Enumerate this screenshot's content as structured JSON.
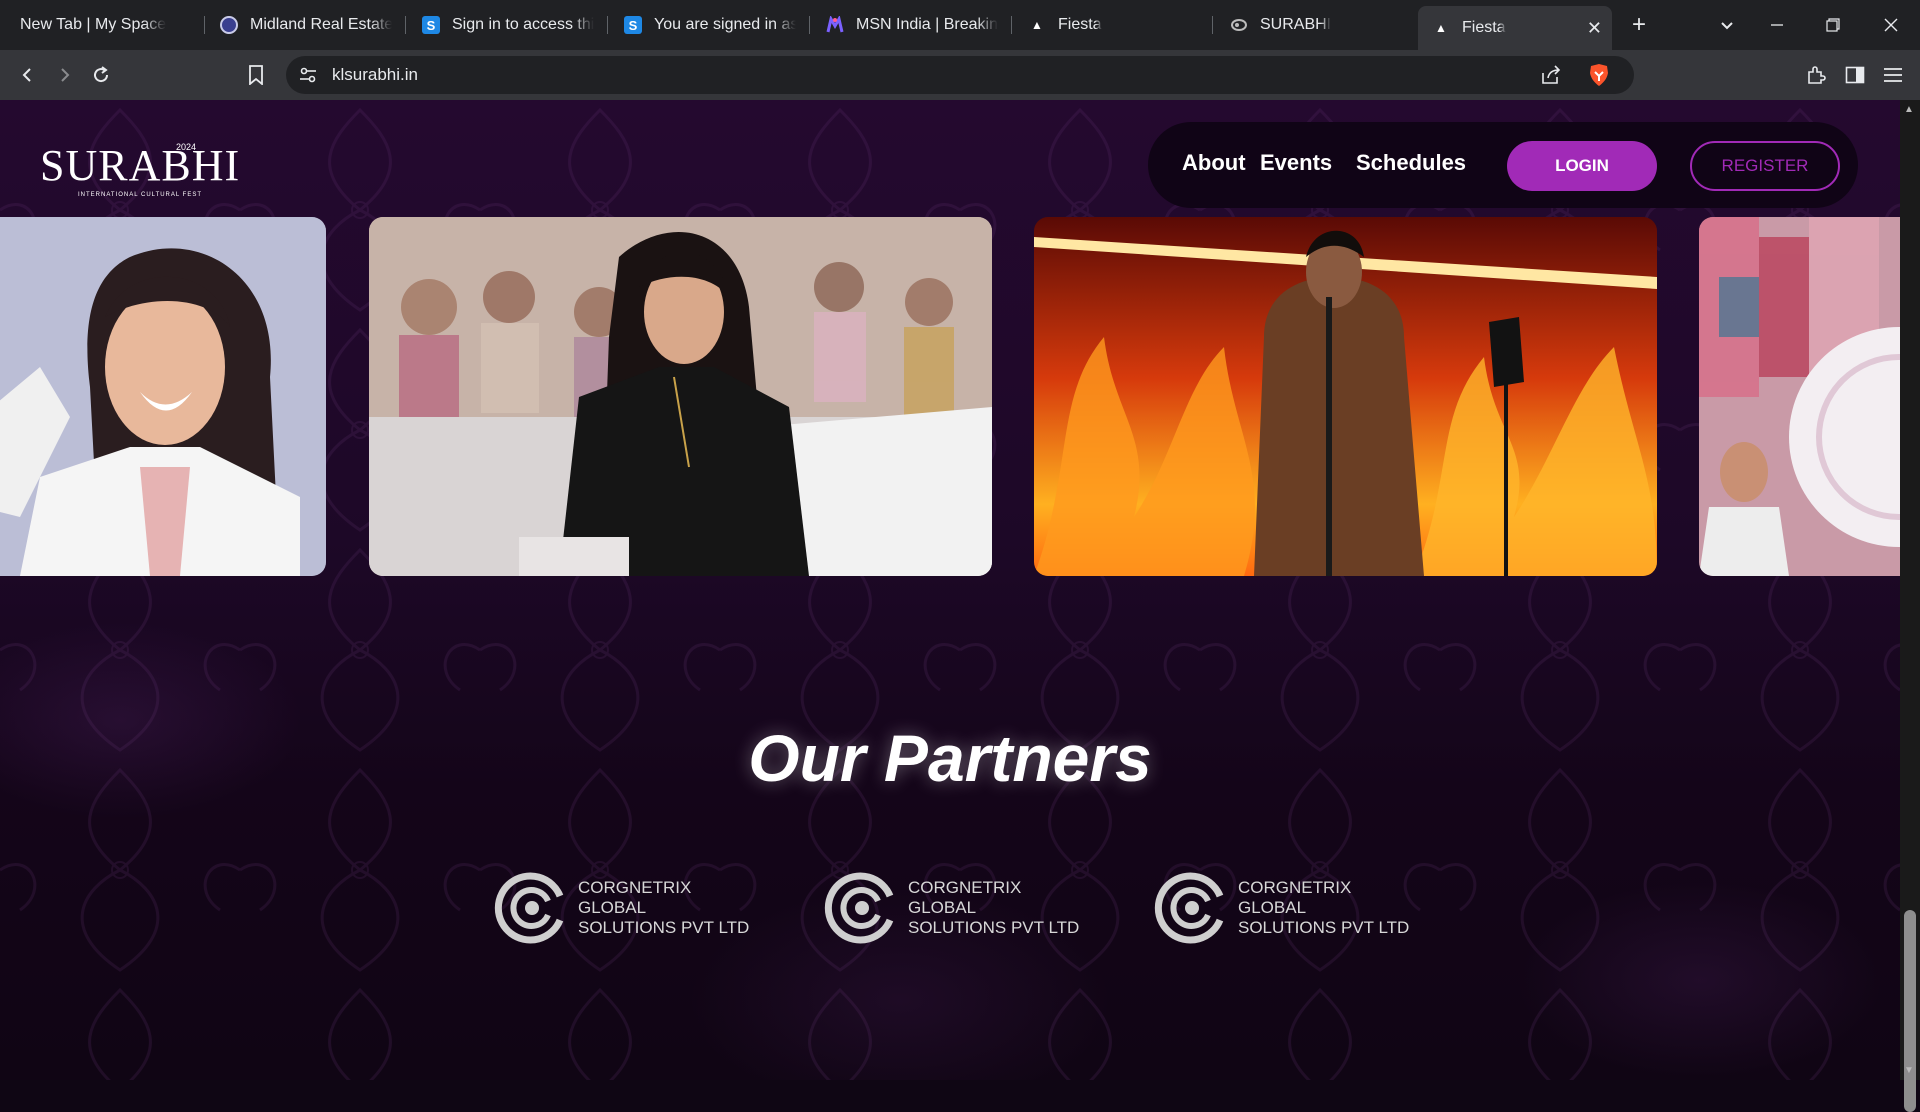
{
  "browser": {
    "tabs": [
      {
        "label": "New Tab | My Space",
        "icon": "none"
      },
      {
        "label": "Midland Real Estate",
        "icon": "site-icon"
      },
      {
        "label": "Sign in to access this",
        "icon": "s-icon"
      },
      {
        "label": "You are signed in as",
        "icon": "s-icon"
      },
      {
        "label": "MSN India | Breaking",
        "icon": "msn-icon"
      },
      {
        "label": "Fiesta",
        "icon": "triangle-icon"
      },
      {
        "label": "SURABHI",
        "icon": "surabhi-icon"
      },
      {
        "label": "Fiesta",
        "icon": "triangle-icon",
        "active": true
      }
    ],
    "url": "klsurabhi.in",
    "colors": {
      "chrome_dark": "#202124",
      "chrome_mid": "#35363a",
      "brave_orange": "#fb542b"
    }
  },
  "site": {
    "logo": {
      "main": "SURABHI",
      "year": "2024",
      "sub": "INTERNATIONAL CULTURAL FEST"
    },
    "nav": {
      "about": "About",
      "events": "Events",
      "schedules": "Schedules",
      "login": "LOGIN",
      "register": "REGISTER"
    },
    "partners_title": "Our Partners",
    "partners": [
      {
        "line1": "CORGNETRIX GLOBAL",
        "line2": "SOLUTIONS PVT LTD"
      },
      {
        "line1": "CORGNETRIX GLOBAL",
        "line2": "SOLUTIONS PVT LTD"
      },
      {
        "line1": "CORGNETRIX GLOBAL",
        "line2": "SOLUTIONS PVT LTD"
      }
    ],
    "colors": {
      "accent": "#a12ab7",
      "background": "#1d0827"
    }
  }
}
